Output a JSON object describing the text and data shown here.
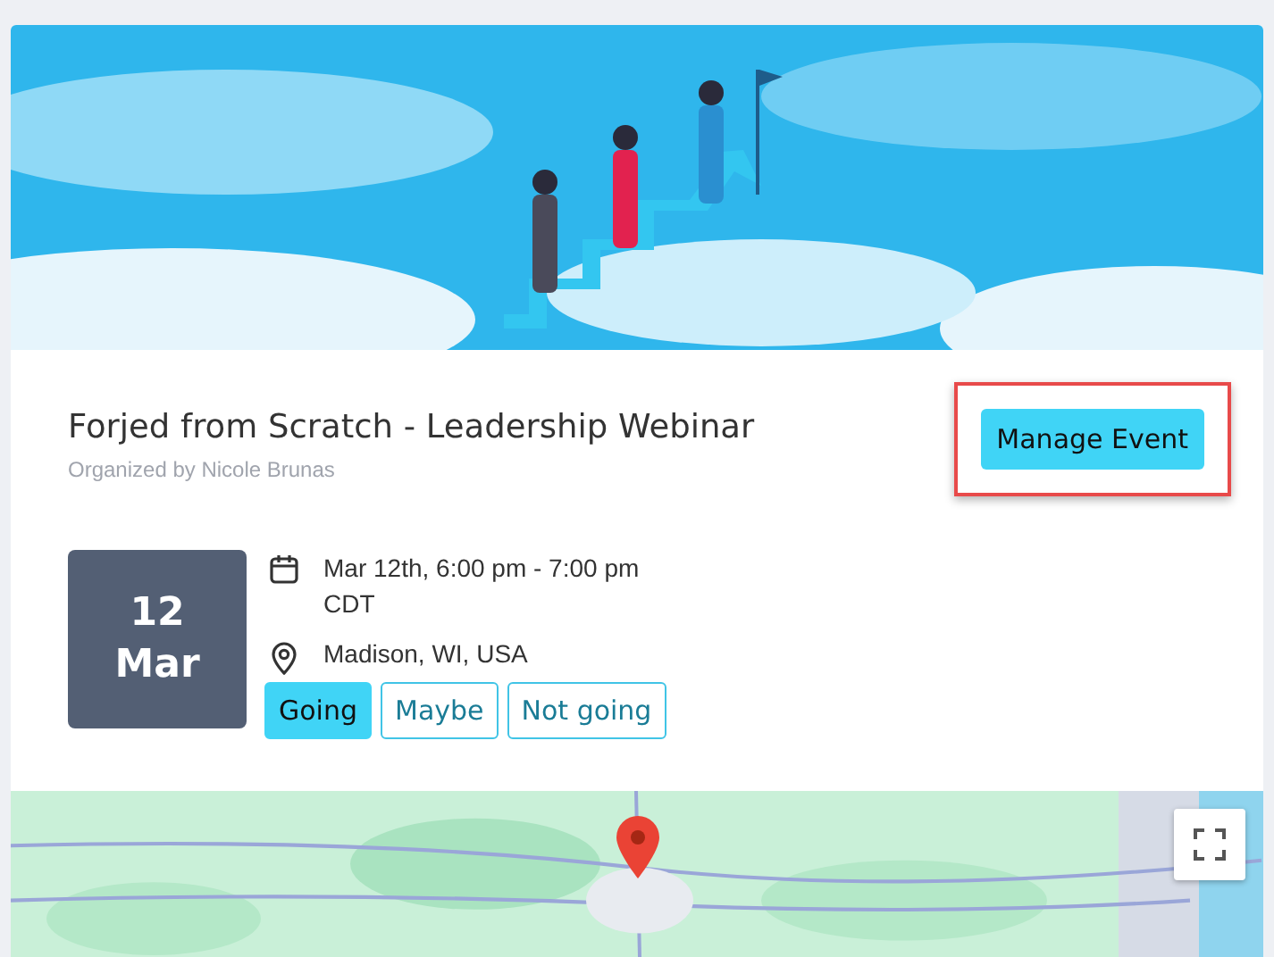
{
  "event": {
    "title": "Forjed from Scratch - Leadership Webinar",
    "organizer": "Organized by Nicole Brunas"
  },
  "manage_button": {
    "label": "Manage Event",
    "highlighted": true
  },
  "date_badge": {
    "day": "12",
    "month": "Mar"
  },
  "details": [
    {
      "kind": "time",
      "text": "Mar 12th, 6:00 pm - 7:00 pm CDT"
    },
    {
      "kind": "location",
      "text": "Madison, WI, USA"
    }
  ],
  "rsvp": [
    {
      "label": "Going",
      "selected": true
    },
    {
      "label": "Maybe",
      "selected": false
    },
    {
      "label": "Not going",
      "selected": false
    }
  ]
}
